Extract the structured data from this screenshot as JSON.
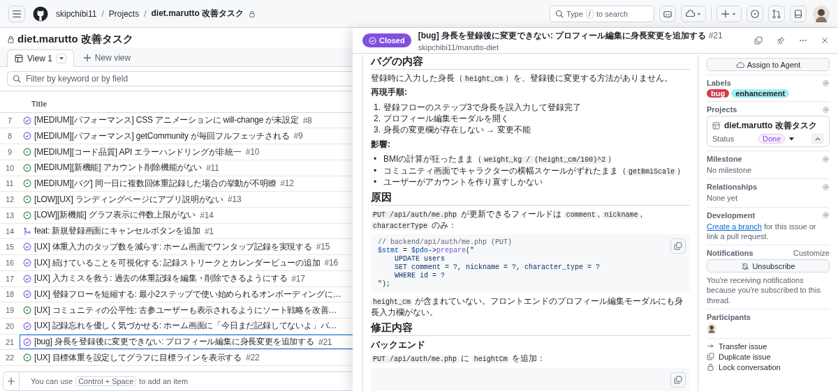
{
  "header": {
    "breadcrumb": [
      "skipchibi11",
      "Projects",
      "diet.marutto 改善タスク"
    ],
    "separator": "/",
    "search": {
      "before": "Type",
      "key": "/",
      "after": "to search"
    }
  },
  "project": {
    "title": "diet.marutto 改善タスク",
    "tabs": [
      {
        "label": "View 1",
        "selected": true,
        "kind": "view"
      },
      {
        "label": "New view",
        "selected": false,
        "kind": "new"
      }
    ],
    "filter": {
      "placeholder": "Filter by keyword or by field"
    },
    "column": "Title",
    "rows": [
      {
        "num": "7",
        "kind": "done",
        "title": "[MEDIUM][パフォーマンス] CSS アニメーションに will-change が未設定",
        "ref": "#8",
        "selected": false
      },
      {
        "num": "8",
        "kind": "done",
        "title": "[MEDIUM][パフォーマンス] getCommunity が毎回フルフェッチされる",
        "ref": "#9",
        "selected": false
      },
      {
        "num": "9",
        "kind": "open",
        "title": "[MEDIUM][コード品質] API エラーハンドリングが非統一",
        "ref": "#10",
        "selected": false
      },
      {
        "num": "10",
        "kind": "open",
        "title": "[MEDIUM][新機能] アカウント削除機能がない",
        "ref": "#11",
        "selected": false
      },
      {
        "num": "11",
        "kind": "open",
        "title": "[MEDIUM][バグ] 同一日に複数回体重記録した場合の挙動が不明瞭",
        "ref": "#12",
        "selected": false
      },
      {
        "num": "12",
        "kind": "open",
        "title": "[LOW][UX] ランディングページにアプリ説明がない",
        "ref": "#13",
        "selected": false
      },
      {
        "num": "13",
        "kind": "open",
        "title": "[LOW][新機能] グラフ表示に件数上限がない",
        "ref": "#14",
        "selected": false
      },
      {
        "num": "14",
        "kind": "pr",
        "title": "feat: 新規登録画面にキャンセルボタンを追加",
        "ref": "#1",
        "selected": false
      },
      {
        "num": "15",
        "kind": "done",
        "title": "[UX] 体重入力のタップ数を減らす: ホーム画面でワンタップ記録を実現する",
        "ref": "#15",
        "selected": false
      },
      {
        "num": "16",
        "kind": "done",
        "title": "[UX] 続けていることを可視化する: 記録ストリークとカレンダービューの追加",
        "ref": "#16",
        "selected": false
      },
      {
        "num": "17",
        "kind": "done",
        "title": "[UX] 入力ミスを救う: 過去の体重記録を編集・削除できるようにする",
        "ref": "#17",
        "selected": false
      },
      {
        "num": "18",
        "kind": "done",
        "title": "[UX] 登録フローを短縮する: 最小2ステップで使い始められるオンボーディングに…",
        "selected": false
      },
      {
        "num": "19",
        "kind": "open",
        "title": "[UX] コミュニティの公平性: 古参ユーザーも表示されるようにソート戦略を改善…",
        "selected": false
      },
      {
        "num": "20",
        "kind": "done",
        "title": "[UX] 記録忘れを優しく気づかせる: ホーム画面に「今日まだ記録してないよ」バ…",
        "selected": false
      },
      {
        "num": "21",
        "kind": "done",
        "title": "[bug] 身長を登録後に変更できない: プロフィール編集に身長変更を追加する",
        "ref": "#21",
        "selected": true
      },
      {
        "num": "22",
        "kind": "open",
        "title": "[UX] 目標体重を設定してグラフに目標ラインを表示する",
        "ref": "#22",
        "selected": false
      }
    ],
    "footer": {
      "before": "You can use",
      "key": "Control + Space",
      "after": "to add an item"
    }
  },
  "issue": {
    "status": "Closed",
    "title": "[bug] 身長を登録後に変更できない: プロフィール編集に身長変更を追加する",
    "number": "#21",
    "repo": "skipchibi11/marutto-diet",
    "body": [
      {
        "kind": "h2",
        "text": "バグの内容"
      },
      {
        "kind": "p",
        "parts": [
          {
            "t": "登録時に入力した身長（"
          },
          {
            "t": "height_cm",
            "code": true
          },
          {
            "t": "）を、登録後に変更する方法がありません。"
          }
        ]
      },
      {
        "kind": "strong",
        "text": "再現手順:"
      },
      {
        "kind": "ol",
        "items": [
          {
            "marker": "1.",
            "text": "登録フローのステップ3で身長を誤入力して登録完了"
          },
          {
            "marker": "2.",
            "text": "プロフィール編集モーダルを開く"
          },
          {
            "marker": "3.",
            "text": "身長の変更欄が存在しない → 変更不能"
          }
        ]
      },
      {
        "kind": "strong",
        "text": "影響:"
      },
      {
        "kind": "ul",
        "items": [
          {
            "marker": "•",
            "parts": [
              {
                "t": "BMIの計算が狂ったまま（"
              },
              {
                "t": "weight_kg / (height_cm/100)^2",
                "code": true
              },
              {
                "t": "）"
              }
            ]
          },
          {
            "marker": "•",
            "parts": [
              {
                "t": "コミュニティ画面でキャラクターの横幅スケールがずれたまま（"
              },
              {
                "t": "getBmiScale",
                "code": true
              },
              {
                "t": "）"
              }
            ]
          },
          {
            "marker": "•",
            "parts": [
              {
                "t": "ユーザーがアカウントを作り直すしかない"
              }
            ]
          }
        ]
      },
      {
        "kind": "h2",
        "text": "原因"
      },
      {
        "kind": "p",
        "parts": [
          {
            "t": "PUT /api/auth/me.php",
            "code": true
          },
          {
            "t": " が更新できるフィールドは "
          },
          {
            "t": "comment",
            "code": true
          },
          {
            "t": ", "
          },
          {
            "t": "nickname",
            "code": true
          },
          {
            "t": ", "
          },
          {
            "t": "characterType",
            "code": true
          },
          {
            "t": " のみ："
          }
        ]
      },
      {
        "kind": "code",
        "lines": [
          [
            {
              "t": "// backend/api/auth/me.php (PUT)",
              "kind": "comment"
            }
          ],
          [
            {
              "t": "$stmt",
              "kind": "var"
            },
            {
              "t": " = ",
              "kind": "plain"
            },
            {
              "t": "$pdo",
              "kind": "var"
            },
            {
              "t": "->",
              "kind": "plain"
            },
            {
              "t": "prepare",
              "kind": "fn"
            },
            {
              "t": "(\"",
              "kind": "plain"
            }
          ],
          [
            {
              "t": "    UPDATE users",
              "kind": "str"
            }
          ],
          [
            {
              "t": "    SET comment = ?, nickname = ?, character_type = ?",
              "kind": "str"
            }
          ],
          [
            {
              "t": "    WHERE id = ?",
              "kind": "str"
            }
          ],
          [
            {
              "t": "\");",
              "kind": "plain"
            }
          ]
        ]
      },
      {
        "kind": "p",
        "parts": [
          {
            "t": "height_cm",
            "code": true
          },
          {
            "t": " が含まれていない。フロントエンドのプロフィール編集モーダルにも身長入力欄がない。"
          }
        ]
      },
      {
        "kind": "h2",
        "text": "修正内容"
      },
      {
        "kind": "h3",
        "text": "バックエンド"
      },
      {
        "kind": "p",
        "parts": [
          {
            "t": "PUT /api/auth/me.php",
            "code": true
          },
          {
            "t": " に "
          },
          {
            "t": "heightCm",
            "code": true
          },
          {
            "t": " を追加："
          }
        ]
      },
      {
        "kind": "code"
      }
    ]
  },
  "sidebar": {
    "assign": "Assign to Agent",
    "labels": {
      "title": "Labels",
      "items": [
        {
          "text": "bug",
          "color": "#d73a4a"
        },
        {
          "text": "enhancement",
          "color": "#a2eeef"
        }
      ]
    },
    "projects": {
      "title": "Projects",
      "name": "diet.marutto 改善タスク",
      "status_label": "Status",
      "status": "Done",
      "expanded": true
    },
    "milestone": {
      "title": "Milestone",
      "value": "No milestone"
    },
    "relationships": {
      "title": "Relationships",
      "value": "None yet"
    },
    "development": {
      "title": "Development",
      "link": "Create a branch",
      "rest": " for this issue or link a pull request."
    },
    "notifications": {
      "title": "Notifications",
      "customize": "Customize",
      "button": "Unsubscribe",
      "note": "You're receiving notifications because you're subscribed to this thread."
    },
    "participants": {
      "title": "Participants"
    },
    "actions": [
      {
        "kind": "transfer",
        "label": "Transfer issue"
      },
      {
        "kind": "duplicate",
        "label": "Duplicate issue"
      },
      {
        "kind": "lock",
        "label": "Lock conversation"
      }
    ]
  }
}
